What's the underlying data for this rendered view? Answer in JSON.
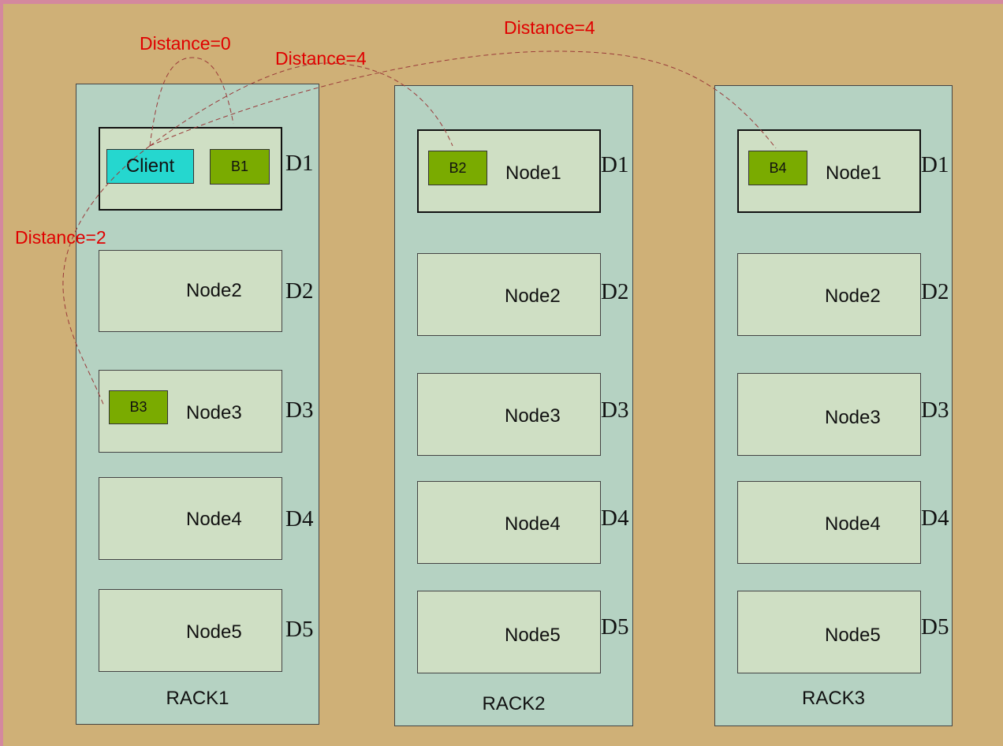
{
  "racks": [
    {
      "label": "RACK1",
      "nodes": [
        {
          "label": "",
          "disk": "D1"
        },
        {
          "label": "Node2",
          "disk": "D2"
        },
        {
          "label": "Node3",
          "disk": "D3"
        },
        {
          "label": "Node4",
          "disk": "D4"
        },
        {
          "label": "Node5",
          "disk": "D5"
        }
      ]
    },
    {
      "label": "RACK2",
      "nodes": [
        {
          "label": "Node1",
          "disk": "D1"
        },
        {
          "label": "Node2",
          "disk": "D2"
        },
        {
          "label": "Node3",
          "disk": "D3"
        },
        {
          "label": "Node4",
          "disk": "D4"
        },
        {
          "label": "Node5",
          "disk": "D5"
        }
      ]
    },
    {
      "label": "RACK3",
      "nodes": [
        {
          "label": "Node1",
          "disk": "D1"
        },
        {
          "label": "Node2",
          "disk": "D2"
        },
        {
          "label": "Node3",
          "disk": "D3"
        },
        {
          "label": "Node4",
          "disk": "D4"
        },
        {
          "label": "Node5",
          "disk": "D5"
        }
      ]
    }
  ],
  "client": {
    "label": "Client"
  },
  "blocks": [
    "B1",
    "B2",
    "B3",
    "B4"
  ],
  "distances": {
    "b1": "Distance=0",
    "b2": "Distance=4",
    "b3": "Distance=2",
    "b4": "Distance=4"
  },
  "colors": {
    "background": "#cfb077",
    "frame": "#d4889e",
    "rack": "#b5d2c2",
    "node": "#cfdfc4",
    "block": "#7aab00",
    "client": "#25d7cf",
    "distance_text": "#e00000",
    "link": "#9a3a3a"
  }
}
